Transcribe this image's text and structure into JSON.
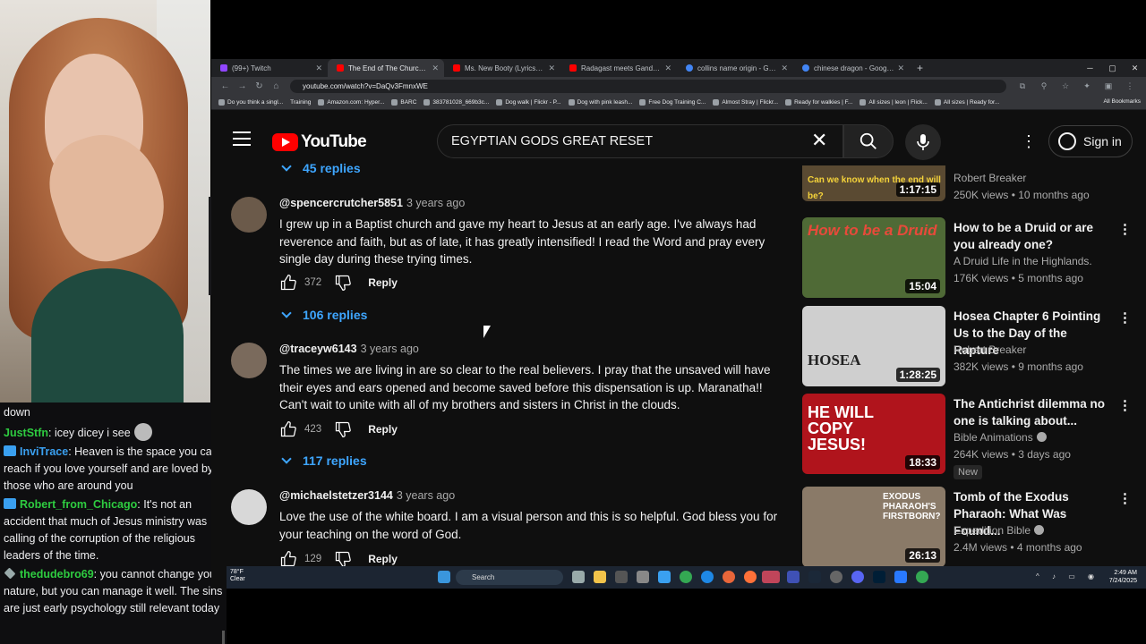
{
  "chat": {
    "messages": [
      {
        "user": "",
        "text": "down",
        "badge": ""
      },
      {
        "user": "JustStfn",
        "color": "#2ecc40",
        "text": "icey dicey i see",
        "badge": "",
        "emote": true
      },
      {
        "user": "InviTrace",
        "color": "#3aa0f0",
        "text": "Heaven is the space you can reach if you love yourself and are loved by those who are around you",
        "badge": "crown"
      },
      {
        "user": "Robert_from_Chicago",
        "color": "#2ecc40",
        "text": "It's not an accident that much of Jesus ministry was calling of the corruption of the religious leaders of the time.",
        "badge": "crown"
      },
      {
        "user": "thedudebro69",
        "color": "#2ecc40",
        "text": "you cannot change your nature, but you can manage it well. The sins are just early psychology still relevant today",
        "badge": "gem"
      }
    ]
  },
  "browser": {
    "tabs": [
      {
        "title": "(99+) Twitch",
        "color": "#9146ff",
        "active": false
      },
      {
        "title": "The End of The Church Age: Th",
        "color": "#ff0000",
        "active": true
      },
      {
        "title": "Ms. New Booty (Lyrics) - Bubba",
        "color": "#ff0000",
        "active": false
      },
      {
        "title": "Radagast meets Gandalf! | The",
        "color": "#ff0000",
        "active": false
      },
      {
        "title": "collins name origin - Google Se",
        "color": "#4285f4",
        "active": false
      },
      {
        "title": "chinese dragon - Google Search",
        "color": "#4285f4",
        "active": false
      }
    ],
    "new_tab": "+",
    "url": "youtube.com/watch?v=DaQv3FmnxWE",
    "bookmarks": [
      "Do you think a singl...",
      "Training",
      "Amazon.com: Hyper...",
      "BARC",
      "383781028_669b3c...",
      "Dog walk | Flickr - P...",
      "Dog with pink leash...",
      "Free Dog Training C...",
      "Almost Stray | Flickr...",
      "Ready for walkies | F...",
      "All sizes | leon | Flick...",
      "All sizes | Ready for..."
    ],
    "all_bookmarks": "All Bookmarks"
  },
  "youtube": {
    "logo_text": "YouTube",
    "search_value": "EGYPTIAN  GODS GREAT RESET",
    "sign_in": "Sign in",
    "top_replies": "45 replies",
    "comments": [
      {
        "author": "@spencercrutcher5851",
        "time": "3 years ago",
        "text": "I grew up in a Baptist church and gave my heart to Jesus at an early age. I've always had reverence and faith, but as of late, it has greatly intensified! I read the Word and pray every single day during these trying times.",
        "likes": "372",
        "reply": "Reply",
        "replies": "106 replies",
        "avatar": "#6b5a4a"
      },
      {
        "author": "@traceyw6143",
        "time": "3 years ago",
        "text": "The times we are living in are so clear to the real believers. I pray that the unsaved will have their eyes and ears opened and become saved before this dispensation is up. Maranatha!! Can't wait to unite with all of my brothers and sisters in Christ in the clouds.",
        "likes": "423",
        "reply": "Reply",
        "replies": "117 replies",
        "avatar": "#7a6a5c"
      },
      {
        "author": "@michaelstetzer3144",
        "time": "3 years ago",
        "text": "Love the use of the white board. I am a visual person and this is so helpful. God bless you for your teaching on the word of God.",
        "likes": "129",
        "reply": "Reply",
        "avatar": "#d8d8d8"
      }
    ],
    "related": [
      {
        "title": "",
        "channel": "Robert Breaker",
        "meta": "250K views • 10 months ago",
        "duration": "1:17:15",
        "thumb": "#5a4a32",
        "thumb_text": "Can we know when the end will be?",
        "thumb_text_color": "#f5d33a"
      },
      {
        "title": "How to be a Druid or are you already one?",
        "channel": "A Druid Life in the Highlands.",
        "meta": "176K views • 5 months ago",
        "duration": "15:04",
        "thumb": "#4f6a36",
        "thumb_text": "How to be a Druid",
        "thumb_text_color": "#e84a3a"
      },
      {
        "title": "Hosea Chapter 6 Pointing Us to the Day of the Rapture",
        "channel": "Robert Breaker",
        "meta": "382K views • 9 months ago",
        "duration": "1:28:25",
        "thumb": "#cfcfcf",
        "thumb_text": "HOSEA",
        "thumb_text_color": "#222"
      },
      {
        "title": "The Antichrist dilemma no one is talking about...",
        "channel": "Bible Animations",
        "meta": "264K views • 3 days ago",
        "duration": "18:33",
        "thumb": "#b0141c",
        "thumb_text": "HE WILL COPY JESUS!",
        "thumb_text_color": "#ffffff",
        "badge": "New",
        "verified": true
      },
      {
        "title": "Tomb of the Exodus Pharaoh: What Was Found...",
        "channel": "Expedition Bible",
        "meta": "2.4M views • 4 months ago",
        "duration": "26:13",
        "thumb": "#8a7a68",
        "thumb_text": "EXODUS PHARAOH'S FIRSTBORN?",
        "thumb_text_color": "#ffffff",
        "verified": true
      }
    ]
  },
  "taskbar": {
    "weather_temp": "78°F",
    "weather_desc": "Clear",
    "search": "Search",
    "time": "2:49 AM",
    "date": "7/24/2025"
  }
}
